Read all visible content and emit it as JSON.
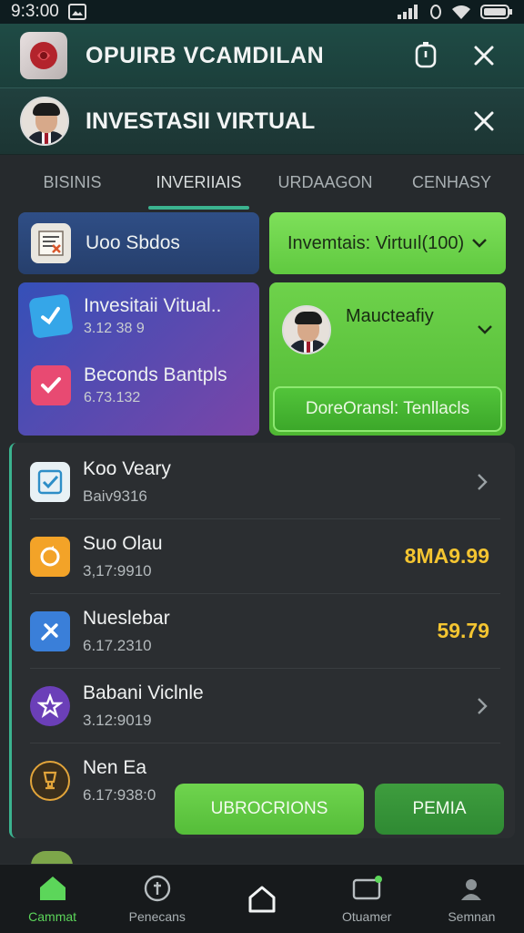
{
  "status_bar": {
    "time": "9:3:00"
  },
  "header": {
    "title": "OPUIRB VCAMDILAN"
  },
  "sub_header": {
    "title": "INVESTASII VIRTUAL"
  },
  "tabs": [
    {
      "label": "BISINIS"
    },
    {
      "label": "INVERIIAIS"
    },
    {
      "label": "URDAAGON"
    },
    {
      "label": "CENHASY"
    }
  ],
  "cards": {
    "sobos": {
      "label": "Uoo Sbdos"
    },
    "virtual": {
      "label": "Invemtais: Virtuıl(100)"
    },
    "purple": {
      "items": [
        {
          "title": "Invesitaii Vitual..",
          "sub": "3.12 38 9"
        },
        {
          "title": "Beconds Bantpls",
          "sub": "6.73.132"
        }
      ]
    },
    "green": {
      "title": "Maucteafiy",
      "button": "DoreOransl: Tenllacls"
    }
  },
  "list": [
    {
      "title": "Koo Veary",
      "sub": "Baiv9316",
      "amount": ""
    },
    {
      "title": "Suo Olau",
      "sub": "3,17:9910",
      "amount": "8MA9.99",
      "amount_color": "#f4c531"
    },
    {
      "title": "Nueslebar",
      "sub": "6.17.2310",
      "amount": "59.79",
      "amount_color": "#f6d23a"
    },
    {
      "title": "Babani Viclnle",
      "sub": "3.12:9019",
      "amount": ""
    },
    {
      "title": "Nen Ea",
      "sub": "6.17:938:0",
      "amount": ""
    }
  ],
  "buttons": {
    "primary": "UBROCRIONS",
    "secondary": "PEMIA"
  },
  "nav": [
    {
      "label": "Cammat",
      "icon": "home-icon"
    },
    {
      "label": "Penecans",
      "icon": "coin-icon"
    },
    {
      "label": "",
      "icon": "home-outline-icon"
    },
    {
      "label": "Otuamer",
      "icon": "wallet-icon"
    },
    {
      "label": "Semnan",
      "icon": "profile-icon"
    }
  ],
  "colors": {
    "accent": "#3bb38f",
    "green": "#5cd65a",
    "amount": "#f4c531"
  }
}
